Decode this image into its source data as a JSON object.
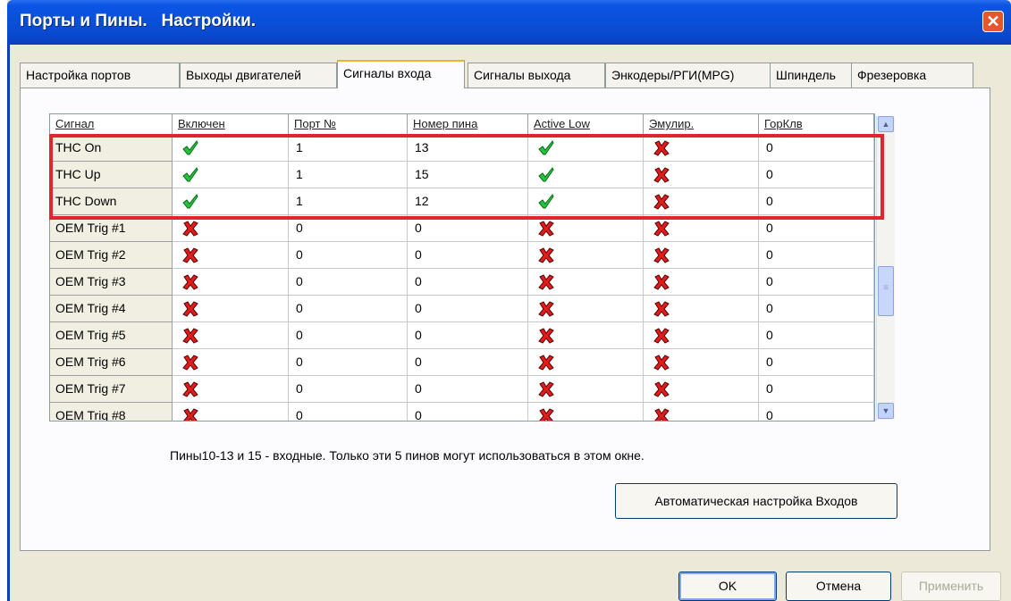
{
  "window": {
    "title": "Порты и Пины.   Настройки.",
    "close_glyph": "✕"
  },
  "tabs": [
    {
      "label": "Настройка портов",
      "active": false
    },
    {
      "label": "Выходы двигателей",
      "active": false
    },
    {
      "label": "Сигналы входа",
      "active": true
    },
    {
      "label": "Сигналы выхода",
      "active": false
    },
    {
      "label": "Энкодеры/РГИ(MPG)",
      "active": false
    },
    {
      "label": "Шпиндель",
      "active": false
    },
    {
      "label": "Фрезеровка",
      "active": false
    }
  ],
  "grid": {
    "columns": [
      "Сигнал",
      "Включен",
      "Порт №",
      "Номер пина",
      "Active Low",
      "Эмулир.",
      "ГорКлв"
    ],
    "rows": [
      {
        "signal": "THC On",
        "enabled": true,
        "port": "1",
        "pin": "13",
        "active_low": true,
        "emulated": false,
        "hotkey": "0"
      },
      {
        "signal": "THC Up",
        "enabled": true,
        "port": "1",
        "pin": "15",
        "active_low": true,
        "emulated": false,
        "hotkey": "0"
      },
      {
        "signal": "THC Down",
        "enabled": true,
        "port": "1",
        "pin": "12",
        "active_low": true,
        "emulated": false,
        "hotkey": "0"
      },
      {
        "signal": "OEM Trig #1",
        "enabled": false,
        "port": "0",
        "pin": "0",
        "active_low": false,
        "emulated": false,
        "hotkey": "0"
      },
      {
        "signal": "OEM Trig #2",
        "enabled": false,
        "port": "0",
        "pin": "0",
        "active_low": false,
        "emulated": false,
        "hotkey": "0"
      },
      {
        "signal": "OEM Trig #3",
        "enabled": false,
        "port": "0",
        "pin": "0",
        "active_low": false,
        "emulated": false,
        "hotkey": "0"
      },
      {
        "signal": "OEM Trig #4",
        "enabled": false,
        "port": "0",
        "pin": "0",
        "active_low": false,
        "emulated": false,
        "hotkey": "0"
      },
      {
        "signal": "OEM Trig #5",
        "enabled": false,
        "port": "0",
        "pin": "0",
        "active_low": false,
        "emulated": false,
        "hotkey": "0"
      },
      {
        "signal": "OEM Trig #6",
        "enabled": false,
        "port": "0",
        "pin": "0",
        "active_low": false,
        "emulated": false,
        "hotkey": "0"
      },
      {
        "signal": "OEM Trig #7",
        "enabled": false,
        "port": "0",
        "pin": "0",
        "active_low": false,
        "emulated": false,
        "hotkey": "0"
      },
      {
        "signal": "OEM Trig #8",
        "enabled": false,
        "port": "0",
        "pin": "0",
        "active_low": false,
        "emulated": false,
        "hotkey": "0"
      }
    ],
    "check_icon": "green-check-icon",
    "cross_icon": "red-x-icon"
  },
  "scrollbar": {
    "up_glyph": "▲",
    "down_glyph": "▼",
    "grip_glyph": "≡"
  },
  "note": "Пины10-13 и 15 - входные. Только эти 5 пинов могут использоваться в этом окне.",
  "buttons": {
    "auto_config": "Автоматическая настройка Входов",
    "ok": "OK",
    "cancel": "Отмена",
    "apply": "Применить"
  },
  "colors": {
    "title_bar": "#0a4fd8",
    "highlight": "#e1252f",
    "check": "#22c43a",
    "cross": "#e01c1c"
  }
}
